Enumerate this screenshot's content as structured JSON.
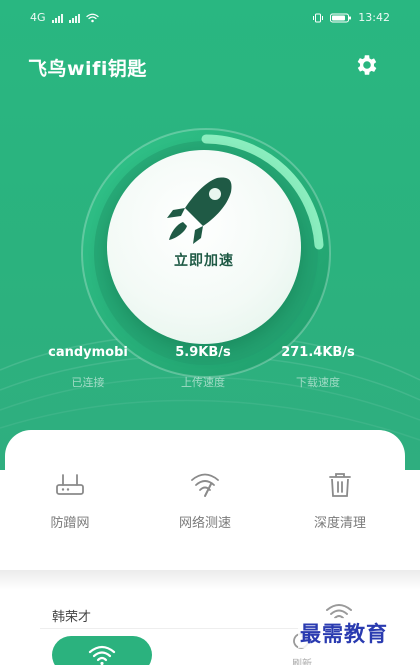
{
  "status_bar": {
    "left_text": "4G",
    "time": "13:42"
  },
  "header": {
    "title": "飞鸟wifi钥匙",
    "settings_icon": "gear-icon"
  },
  "accelerate": {
    "label": "立即加速",
    "icon": "rocket-icon"
  },
  "stats": [
    {
      "value": "candymobi",
      "label": "已连接"
    },
    {
      "value": "5.9KB/s",
      "label": "上传速度"
    },
    {
      "value": "271.4KB/s",
      "label": "下载速度"
    }
  ],
  "functions": [
    {
      "label": "防蹭网",
      "icon": "router-icon"
    },
    {
      "label": "网络测速",
      "icon": "wifi-speed-icon"
    },
    {
      "label": "深度清理",
      "icon": "trash-icon"
    }
  ],
  "network": {
    "name": "韩荣才",
    "icon": "wifi-icon"
  },
  "bottom_nav": {
    "wifi_icon": "wifi-icon",
    "refresh_icon": "refresh-icon",
    "text": "刷新"
  },
  "watermark": "最需教育",
  "colors": {
    "primary": "#2bb27e",
    "accent_light": "#7ee8b4",
    "background": "#ffffff"
  }
}
